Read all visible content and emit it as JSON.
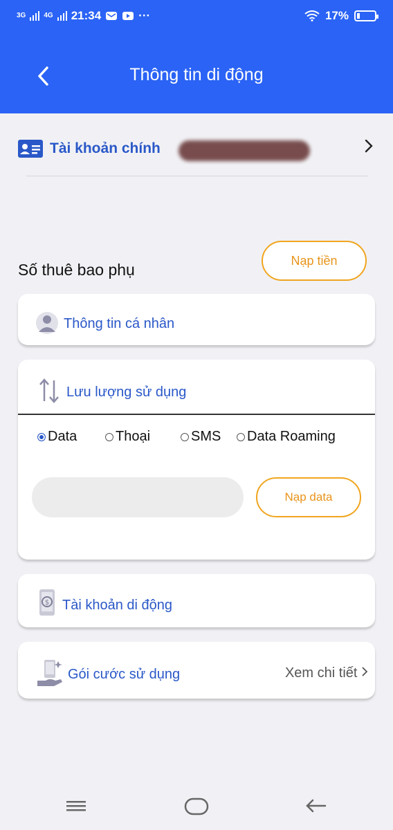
{
  "status_bar": {
    "net1": "3G",
    "net2": "4G",
    "time": "21:34",
    "battery": "17%",
    "battery_level": 0.17
  },
  "header": {
    "title": "Thông tin di động",
    "back_icon": "back-chevron-icon"
  },
  "account": {
    "label": "Tài khoản chính",
    "icon": "id-card-icon"
  },
  "subscriber": {
    "title": "Số thuê bao phụ",
    "topup_label": "Nạp tiền"
  },
  "personal_info": {
    "label": "Thông tin cá nhân",
    "icon": "person-icon"
  },
  "usage": {
    "label": "Lưu lượng sử dụng",
    "icon": "up-down-arrows-icon",
    "options": [
      "Data",
      "Thoại",
      "SMS",
      "Data Roaming"
    ],
    "selected": "Data",
    "data_btn_label": "Nạp data"
  },
  "mobile_account": {
    "label": "Tài khoản di động",
    "icon": "money-phone-icon"
  },
  "plan": {
    "label": "Gói cước sử dụng",
    "icon": "hand-phone-icon",
    "detail_label": "Xem chi tiết"
  },
  "colors": {
    "header_bg": "#2a63f5",
    "accent_blue": "#2a58c8",
    "accent_orange": "#f0a51e",
    "page_bg": "#f1f1f5"
  }
}
